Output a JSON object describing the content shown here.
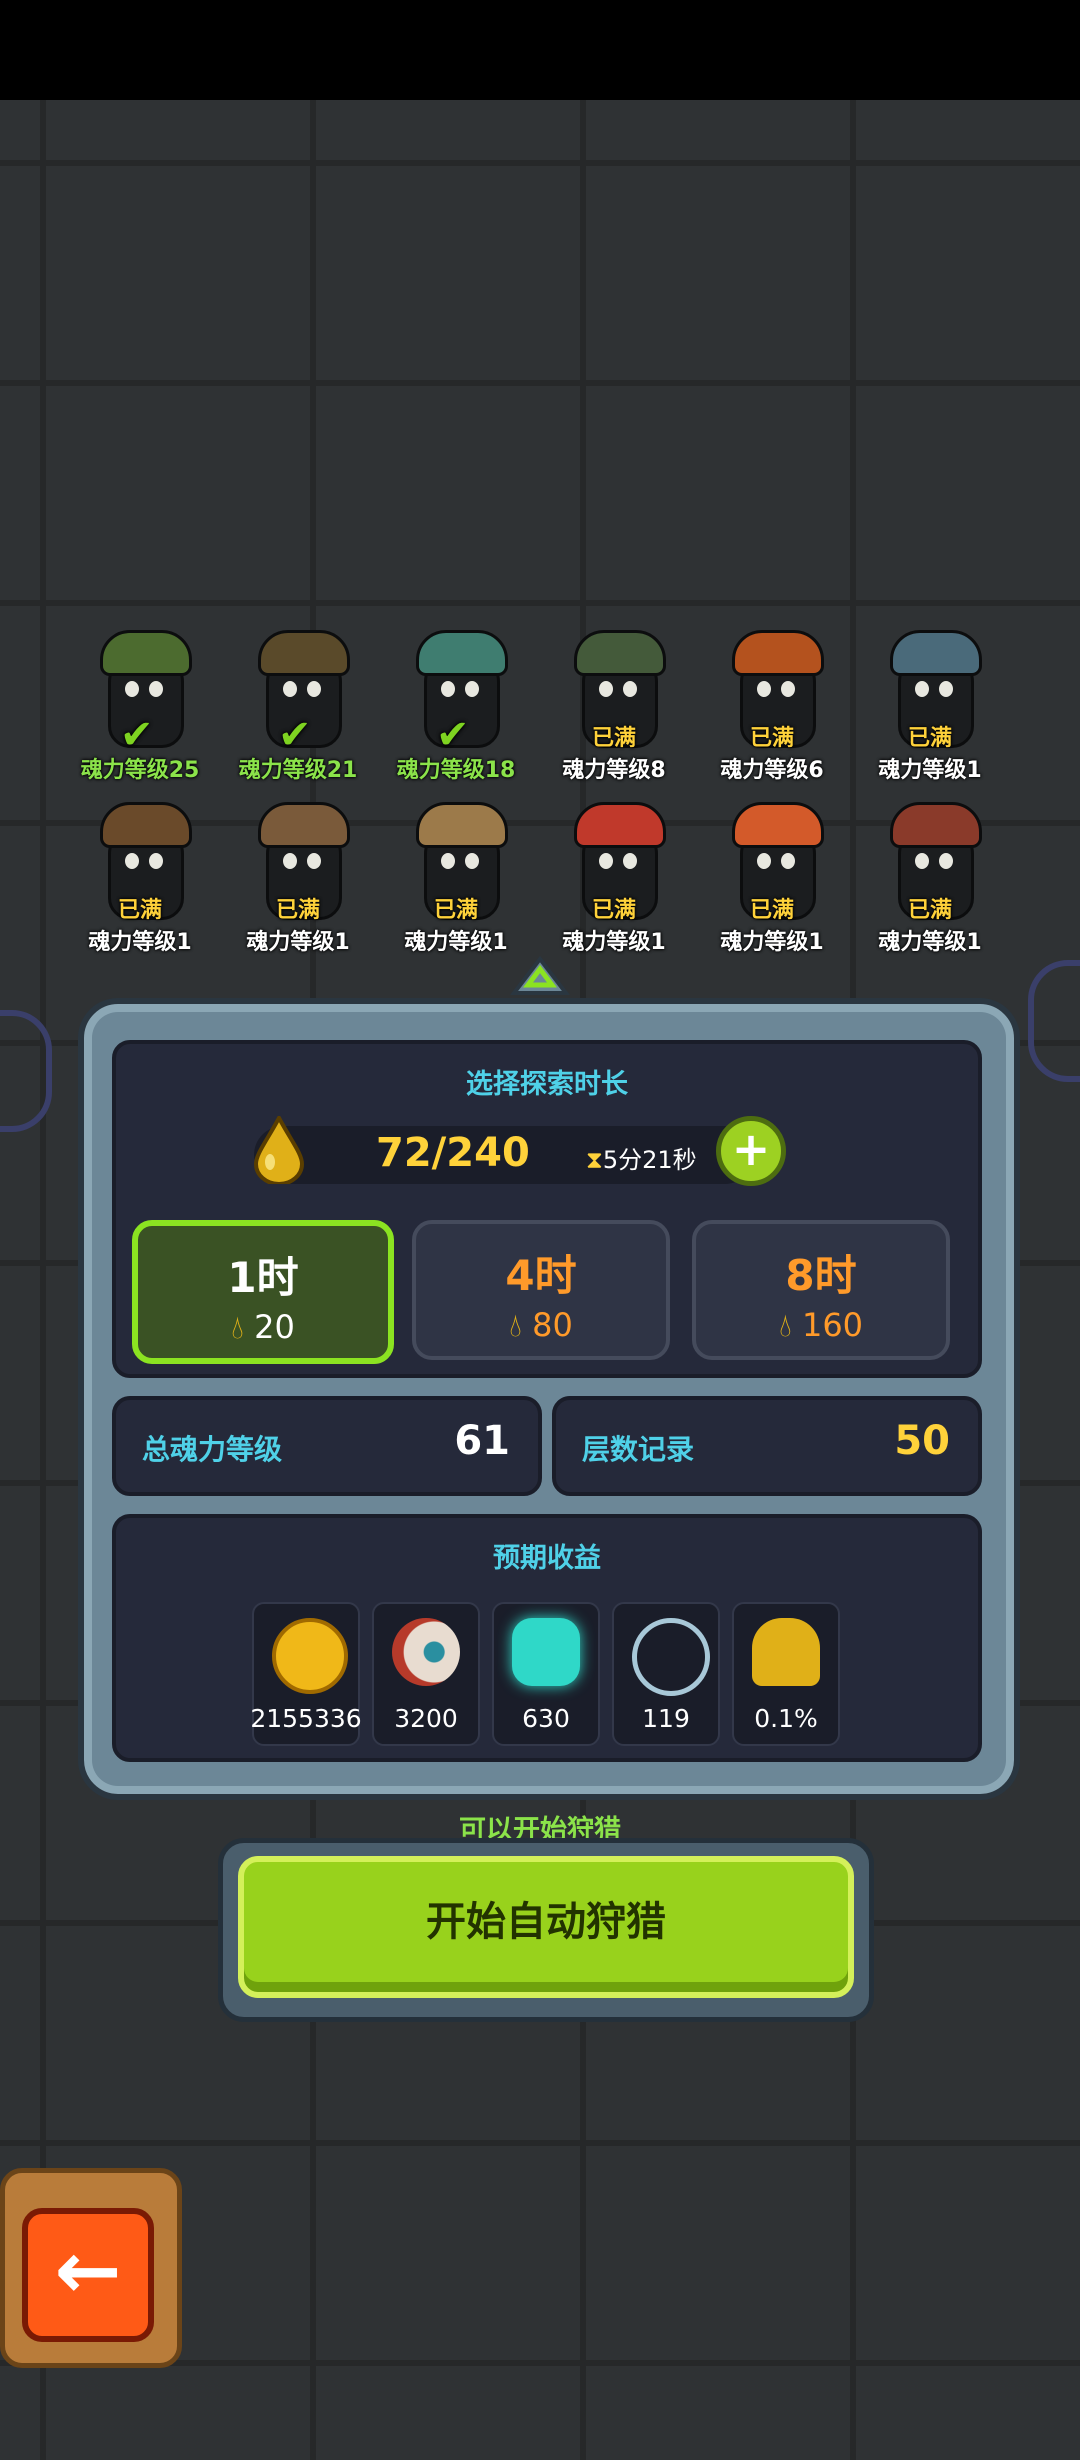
{
  "heroes": [
    {
      "level": "魂力等级25",
      "status": "check",
      "hat_color": "#4c6b2f"
    },
    {
      "level": "魂力等级21",
      "status": "check",
      "hat_color": "#5a4a2a"
    },
    {
      "level": "魂力等级18",
      "status": "check",
      "hat_color": "#3f7d70"
    },
    {
      "level": "魂力等级8",
      "status": "已满",
      "hat_color": "#445a3a"
    },
    {
      "level": "魂力等级6",
      "status": "已满",
      "hat_color": "#b4521e"
    },
    {
      "level": "魂力等级1",
      "status": "已满",
      "hat_color": "#4a6a7a"
    },
    {
      "level": "魂力等级1",
      "status": "已满",
      "hat_color": "#6a4a2a"
    },
    {
      "level": "魂力等级1",
      "status": "已满",
      "hat_color": "#7a5a3a"
    },
    {
      "level": "魂力等级1",
      "status": "已满",
      "hat_color": "#9c7a4a"
    },
    {
      "level": "魂力等级1",
      "status": "已满",
      "hat_color": "#c0392b"
    },
    {
      "level": "魂力等级1",
      "status": "已满",
      "hat_color": "#d35a2a"
    },
    {
      "level": "魂力等级1",
      "status": "已满",
      "hat_color": "#8a3a2a"
    }
  ],
  "panel": {
    "title": "选择探索时长",
    "energy": "72/240",
    "timer": "5分21秒",
    "plus_icon": "plus-icon",
    "options": [
      {
        "label": "1时",
        "cost": "20",
        "selected": true
      },
      {
        "label": "4时",
        "cost": "80",
        "selected": false
      },
      {
        "label": "8时",
        "cost": "160",
        "selected": false
      }
    ],
    "total_level_label": "总魂力等级",
    "total_level_value": "61",
    "floor_record_label": "层数记录",
    "floor_record_value": "50",
    "rewards_title": "预期收益",
    "rewards": [
      {
        "icon": "gold-coin-icon",
        "value": "2155336"
      },
      {
        "icon": "eyeball-icon",
        "value": "3200"
      },
      {
        "icon": "soul-crystal-icon",
        "value": "630"
      },
      {
        "icon": "skeleton-fish-icon",
        "value": "119"
      },
      {
        "icon": "golden-figure-icon",
        "value": "0.1%"
      }
    ]
  },
  "can_start_text": "可以开始狩猎",
  "start_button": "开始自动狩猎",
  "colors": {
    "accent_green": "#98d21c",
    "cyan_text": "#4fd1e8",
    "gold": "#ffd23a",
    "orange": "#ff9a2a"
  }
}
